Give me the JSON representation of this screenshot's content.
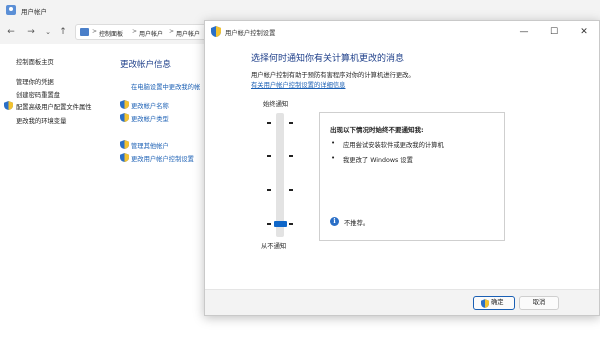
{
  "background_window": {
    "title": "用户帐户",
    "nav": {
      "back": "←",
      "forward": "→",
      "dropdown": "⌄",
      "up": "↑"
    },
    "breadcrumb": [
      "控制面板",
      "用户帐户",
      "用户帐户"
    ],
    "breadcrumb_sep": ">",
    "left_panel": {
      "items": [
        "控制面板主页",
        "管理你的凭据",
        "创建密码重置盘",
        "配置高级用户配置文件属性",
        "更改我的环境变量"
      ]
    },
    "main": {
      "title": "更改帐户信息",
      "settings_link": "在电脑设置中更改我的帐",
      "links": [
        "更改帐户名称",
        "更改帐户类型",
        "管理其他帐户",
        "更改用户帐户控制设置"
      ]
    }
  },
  "dialog": {
    "title": "用户帐户控制设置",
    "window_controls": {
      "minimize": "—",
      "maximize": "☐",
      "close": "✕"
    },
    "heading": "选择何时通知你有关计算机更改的消息",
    "description": "用户帐户控制有助于预防有害程序对你的计算机进行更改。",
    "more_link": "有关用户帐户控制设置的详细信息",
    "slider": {
      "top_label": "始终通知",
      "bottom_label": "从不通知",
      "levels": 4,
      "selected_level": 1
    },
    "info": {
      "heading": "出现以下情况时始终不要通知我:",
      "bullets": [
        "应用尝试安装软件或更改我的计算机",
        "我更改了 Windows 设置"
      ],
      "bullet_symbol": "•",
      "note_icon": "i",
      "note": "不推荐。"
    },
    "buttons": {
      "ok": "确定",
      "cancel": "取消"
    }
  },
  "colors": {
    "accent": "#0f67c9",
    "heading_blue": "#1e3f8a",
    "link_blue": "#1a5fb4"
  }
}
